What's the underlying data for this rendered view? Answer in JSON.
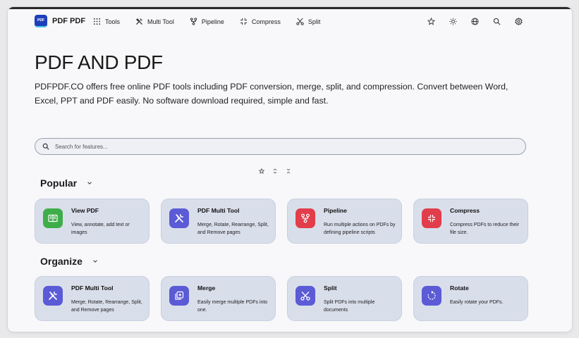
{
  "brand": {
    "logo_text": "PDF",
    "name": "PDF PDF"
  },
  "nav": {
    "items": [
      {
        "label": "Tools",
        "icon": "grid-icon"
      },
      {
        "label": "Multi Tool",
        "icon": "tools-icon"
      },
      {
        "label": "Pipeline",
        "icon": "pipeline-icon"
      },
      {
        "label": "Compress",
        "icon": "compress-icon"
      },
      {
        "label": "Split",
        "icon": "scissors-icon"
      }
    ],
    "right_icons": [
      "star-icon",
      "sun-icon",
      "globe-icon",
      "search-icon",
      "gear-icon"
    ]
  },
  "hero": {
    "title": "PDF AND PDF",
    "description": "PDFPDF.CO offers free online PDF tools including PDF conversion, merge, split, and compression. Convert between Word, Excel, PPT and PDF easily. No software download required, simple and fast."
  },
  "search": {
    "placeholder": "Search for features..."
  },
  "sections": [
    {
      "title": "Popular",
      "cards": [
        {
          "title": "View PDF",
          "desc": "View, annotate, add text or images",
          "icon": "book-icon",
          "color": "#3fae4a"
        },
        {
          "title": "PDF Multi Tool",
          "desc": "Merge, Rotate, Rearrange, Split, and Remove pages",
          "icon": "tools-icon",
          "color": "#5b5bd6"
        },
        {
          "title": "Pipeline",
          "desc": "Run multiple actions on PDFs by defining pipeline scripts",
          "icon": "pipeline-icon",
          "color": "#e23d4a"
        },
        {
          "title": "Compress",
          "desc": "Compress PDFs to reduce their file size.",
          "icon": "compress-icon",
          "color": "#e23d4a"
        }
      ]
    },
    {
      "title": "Organize",
      "cards": [
        {
          "title": "PDF Multi Tool",
          "desc": "Merge, Rotate, Rearrange, Split, and Remove pages",
          "icon": "tools-icon",
          "color": "#5b5bd6"
        },
        {
          "title": "Merge",
          "desc": "Easily merge multiple PDFs into one.",
          "icon": "merge-icon",
          "color": "#5b5bd6"
        },
        {
          "title": "Split",
          "desc": "Split PDFs into multiple documents",
          "icon": "scissors-icon",
          "color": "#5b5bd6"
        },
        {
          "title": "Rotate",
          "desc": "Easily rotate your PDFs.",
          "icon": "rotate-icon",
          "color": "#5b5bd6"
        }
      ]
    }
  ]
}
